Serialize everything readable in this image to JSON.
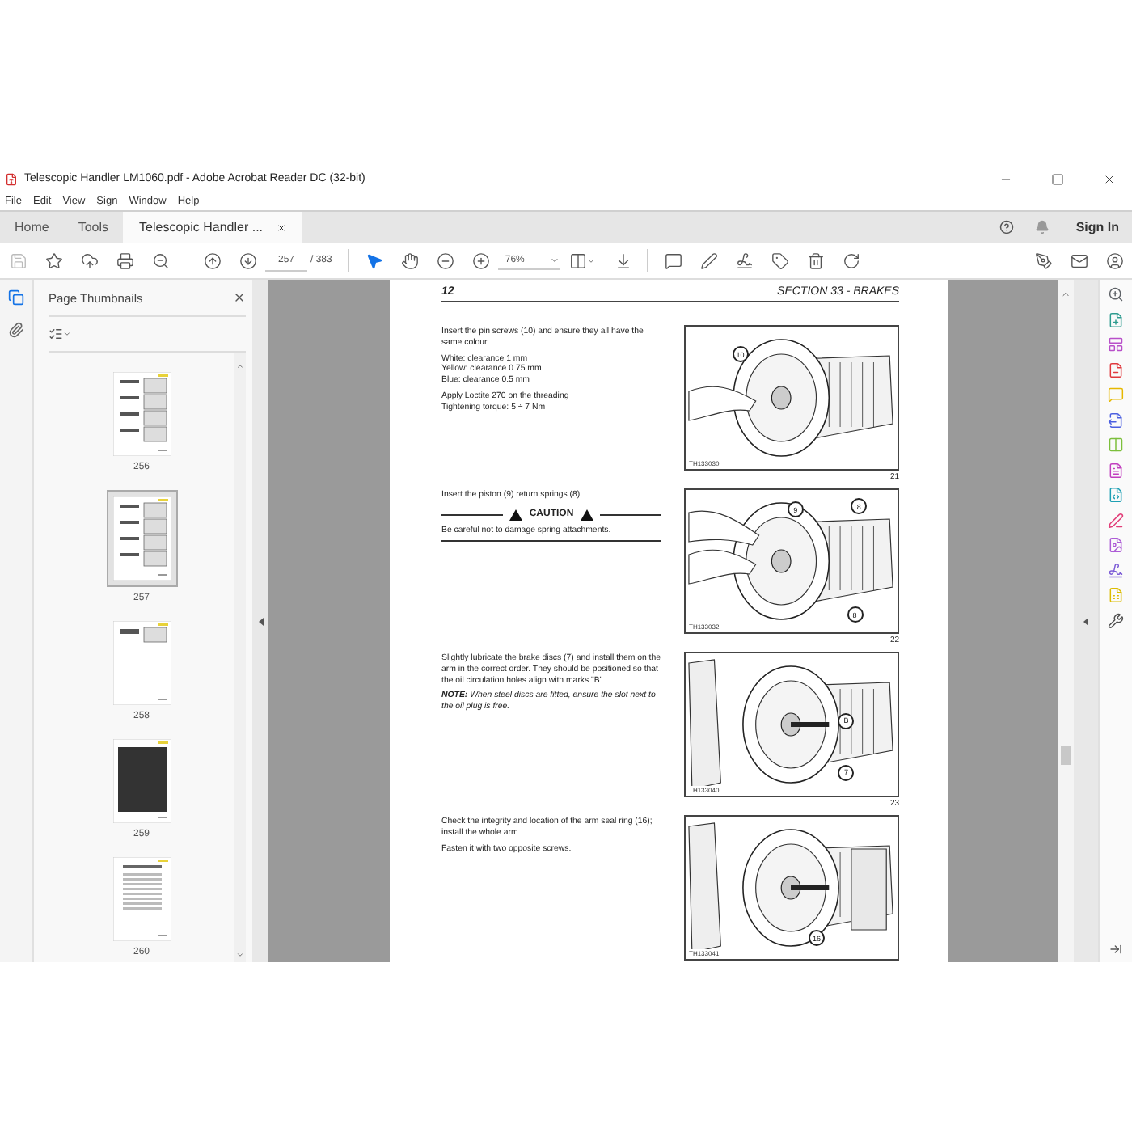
{
  "window": {
    "title": "Telescopic Handler LM1060.pdf - Adobe Acrobat Reader DC (32-bit)"
  },
  "menu": [
    "File",
    "Edit",
    "View",
    "Sign",
    "Window",
    "Help"
  ],
  "tabs": [
    {
      "label": "Home",
      "selected": false
    },
    {
      "label": "Tools",
      "selected": false
    },
    {
      "label": "Telescopic Handler ...",
      "selected": true
    }
  ],
  "account": {
    "sign_in": "Sign In"
  },
  "toolbar": {
    "page": "257",
    "page_count": "/ 383",
    "zoom": "76%"
  },
  "side_rail": [
    {
      "kind": "pages",
      "selected": true
    },
    {
      "kind": "attachments",
      "selected": false
    }
  ],
  "thumbnail_panel": {
    "title": "Page Thumbnails",
    "thumbnails": [
      {
        "label": "256",
        "selected": false
      },
      {
        "label": "257",
        "selected": true
      },
      {
        "label": "258",
        "selected": false
      },
      {
        "label": "259",
        "selected": false
      },
      {
        "label": "260",
        "selected": false
      }
    ]
  },
  "document": {
    "page_number": "12",
    "section": "SECTION 33 - BRAKES",
    "steps": [
      {
        "paragraphs": [
          {
            "kind": "text",
            "text": "Insert the pin screws (10) and ensure they all have the same colour."
          },
          {
            "kind": "text",
            "text": "White: clearance 1 mm\nYellow: clearance 0.75 mm\nBlue: clearance 0.5 mm"
          },
          {
            "kind": "text",
            "text": "Apply Loctite 270 on the threading\nTightening torque: 5 ÷ 7 Nm"
          }
        ],
        "figure": {
          "code": "TH133030",
          "number": "21",
          "callouts": [
            "10"
          ]
        }
      },
      {
        "paragraphs": [
          {
            "kind": "text",
            "text": "Insert the piston (9) return springs (8)."
          },
          {
            "kind": "caution",
            "title": "CAUTION",
            "text": "Be careful not to damage spring attachments."
          }
        ],
        "figure": {
          "code": "TH133032",
          "number": "22",
          "callouts": [
            "9",
            "8",
            "8"
          ]
        }
      },
      {
        "paragraphs": [
          {
            "kind": "text",
            "text": "Slightly lubricate the brake discs (7) and install them on the arm in the correct order. They should be positioned so that the oil circulation holes align with marks \"B\"."
          },
          {
            "kind": "note",
            "text": "**NOTE:** When steel discs are fitted, ensure the slot next to the oil plug is free."
          }
        ],
        "figure": {
          "code": "TH133040",
          "number": "23",
          "callouts": [
            "B",
            "7"
          ]
        }
      },
      {
        "paragraphs": [
          {
            "kind": "text",
            "text": "Check the integrity and location of the arm seal ring (16); install the whole arm."
          },
          {
            "kind": "text",
            "text": "Fasten it with two opposite screws."
          }
        ],
        "figure": {
          "code": "TH133041",
          "callouts": [
            "16"
          ]
        }
      }
    ]
  },
  "tools_rail": [
    {
      "color": "#5f6368"
    },
    {
      "color": "#2e9b8f"
    },
    {
      "color": "#b84fc9"
    },
    {
      "color": "#e0393e"
    },
    {
      "color": "#e6b800"
    },
    {
      "color": "#4b5fe0"
    },
    {
      "color": "#7cbf3c"
    },
    {
      "color": "#c13fbf"
    },
    {
      "color": "#1fa0b4"
    },
    {
      "color": "#e23d78"
    },
    {
      "color": "#ad5cd6"
    },
    {
      "color": "#7c5cd6"
    },
    {
      "color": "#dcbc00"
    },
    {
      "color": "#505050"
    }
  ]
}
